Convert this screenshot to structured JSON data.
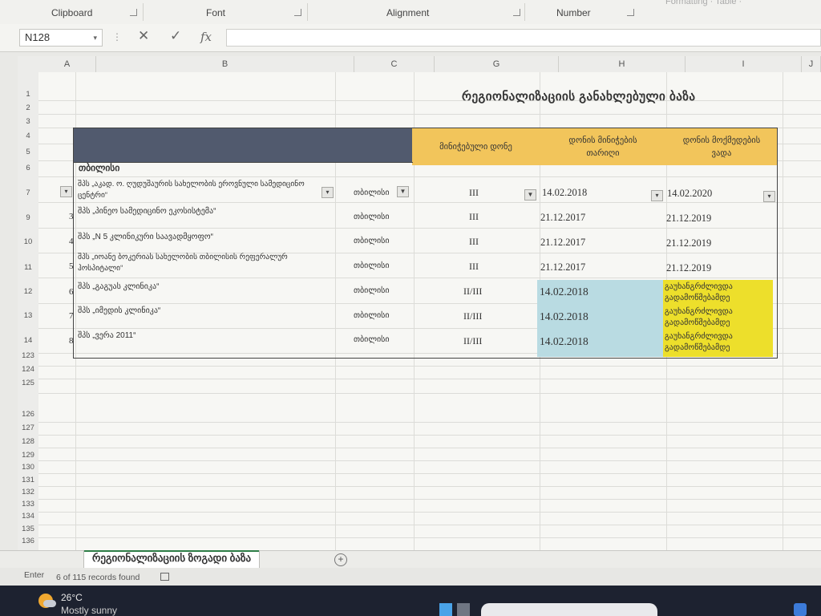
{
  "ribbon": {
    "groups": [
      "Clipboard",
      "Font",
      "Alignment",
      "Number"
    ],
    "right_faded": "Formatting ·  Table ·"
  },
  "formula_bar": {
    "name_box": "N128",
    "cancel_glyph": "✕",
    "enter_glyph": "✓",
    "fx_label": "fx",
    "formula": ""
  },
  "columns": [
    "A",
    "B",
    "C",
    "G",
    "H",
    "I",
    "J"
  ],
  "rows": [
    "1",
    "2",
    "3",
    "4",
    "5",
    "6",
    "7",
    "9",
    "10",
    "11",
    "12",
    "13",
    "14",
    "123",
    "124",
    "125",
    "126",
    "127",
    "128",
    "129",
    "130",
    "131",
    "132",
    "133",
    "134",
    "135",
    "136"
  ],
  "sheet": {
    "title": "რეგიონალიზაციის განახლებული ბაზა",
    "section": "თბილისი",
    "headers": {
      "level": "მინიჭებული დონე",
      "assigned_date": "დონის მინიჭების თარიღი",
      "validity": "დონის მოქმედების ვადა"
    },
    "records": [
      {
        "num": "",
        "name": "შპს „აკად. ო. ღუდუშაურის სახელობის ეროვნული სამედიცინო ცენტრი“",
        "city": "თბილისი",
        "level": "III",
        "date": "14.02.2018",
        "valid": "14.02.2020"
      },
      {
        "num": "3",
        "name": "შპს „პინეო სამედიცინო ეკოსისტემა“",
        "city": "თბილისი",
        "level": "III",
        "date": "21.12.2017",
        "valid": "21.12.2019"
      },
      {
        "num": "4",
        "name": "შპს „N 5 კლინიკური საავადმყოფო“",
        "city": "თბილისი",
        "level": "III",
        "date": "21.12.2017",
        "valid": "21.12.2019"
      },
      {
        "num": "5",
        "name": "შპს „იოანე ბოკერიას სახელობის თბილისის რეფერალურ ჰოსპიტალი“",
        "city": "თბილისი",
        "level": "III",
        "date": "21.12.2017",
        "valid": "21.12.2019"
      },
      {
        "num": "6",
        "name": "შპს „გაგუას კლინიკა“",
        "city": "თბილისი",
        "level": "II/III",
        "date": "14.02.2018",
        "valid": "გაუხანგრძლივდა გადამოწმებამდე"
      },
      {
        "num": "7",
        "name": "შპს „იმედის კლინიკა“",
        "city": "თბილისი",
        "level": "II/III",
        "date": "14.02.2018",
        "valid": "გაუხანგრძლივდა გადამოწმებამდე"
      },
      {
        "num": "8",
        "name": "შპს „ვერა 2011“",
        "city": "თბილისი",
        "level": "II/III",
        "date": "14.02.2018",
        "valid": "გაუხანგრძლივდა გადამოწმებამდე"
      }
    ]
  },
  "tabs": {
    "active": "რეგიონალიზაციის ზოგადი ბაზა",
    "add_glyph": "+"
  },
  "status": {
    "mode": "Enter",
    "records": "6 of 115 records found"
  },
  "taskbar": {
    "temperature": "26°C",
    "condition": "Mostly sunny"
  },
  "colors": {
    "header_navy": "#515a6e",
    "header_yellow": "#f2c55b",
    "date_blue": "#b9dbe2",
    "valid_yellow": "#eddf2b"
  }
}
